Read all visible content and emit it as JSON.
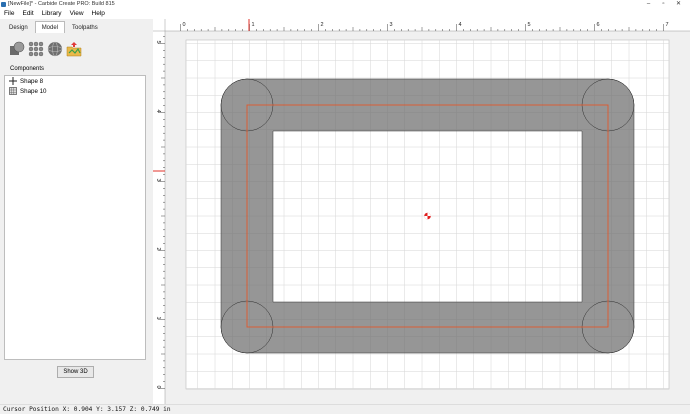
{
  "window": {
    "title": "[NewFile]* - Carbide Create PRO: Build 815",
    "minimize": "–",
    "maximize": "▫",
    "close": "✕"
  },
  "menu": {
    "items": [
      "File",
      "Edit",
      "Library",
      "View",
      "Help"
    ]
  },
  "left_panel": {
    "tabs": [
      "Design",
      "Model",
      "Toolpaths"
    ],
    "active_tab": "Model",
    "tools": [
      "model-shapes-icon",
      "texture-icon",
      "sphere-icon",
      "import-model-icon"
    ],
    "components_label": "Components",
    "components": [
      {
        "name": "Shape 8",
        "icon": "plus-move-icon"
      },
      {
        "name": "Shape 10",
        "icon": "shape-grid-icon"
      }
    ],
    "show3d_label": "Show 3D"
  },
  "canvas": {
    "x_ticks": [
      "0",
      "1",
      "2",
      "3",
      "4",
      "5",
      "6",
      "7"
    ],
    "y_ticks": [
      "0",
      "1",
      "2",
      "3",
      "4",
      "5"
    ],
    "colors": {
      "grid": "#d6d6d6",
      "shape_fill": "#707070",
      "toolpath": "#e0582c",
      "marker": "#e02020",
      "ruler_cursor": "#e0302a"
    }
  },
  "status": {
    "text": "Cursor Position X: 0.904 Y: 3.157 Z: 0.749 in"
  }
}
